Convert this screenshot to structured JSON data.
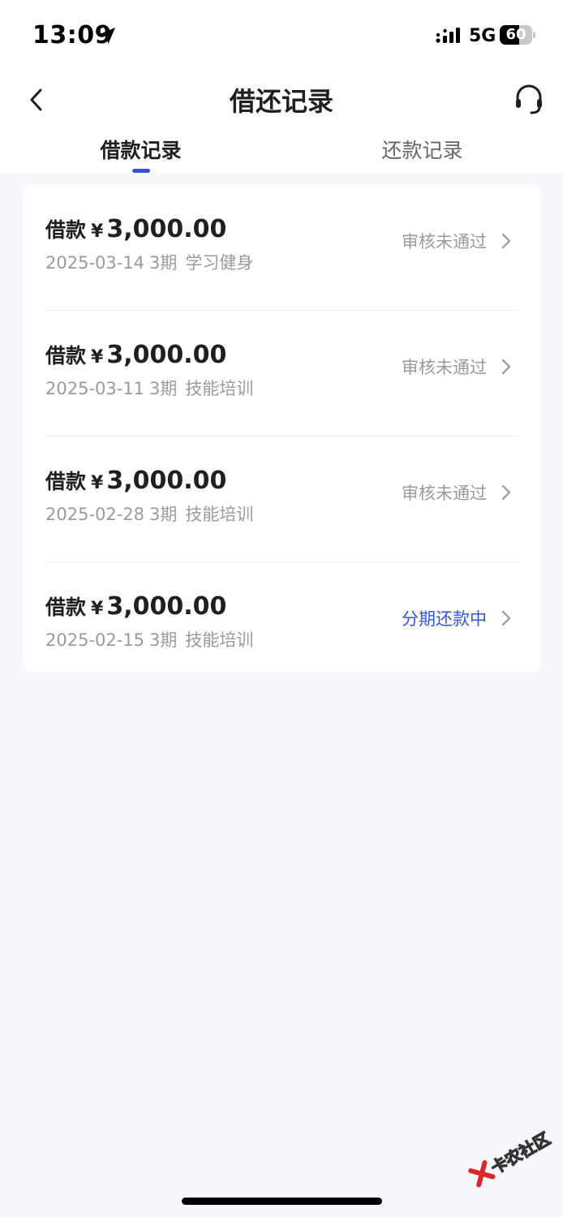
{
  "status_bar": {
    "time": "13:09",
    "network": "5G",
    "battery": "60",
    "battery_level": 0.6
  },
  "nav": {
    "title": "借还记录",
    "back_icon": "chevron-left-icon",
    "service_icon": "headset-icon"
  },
  "tabs": [
    {
      "label": "借款记录",
      "active": true
    },
    {
      "label": "还款记录",
      "active": false
    }
  ],
  "records": [
    {
      "label": "借款",
      "currency": "¥",
      "amount": "3,000.00",
      "date": "2025-03-14",
      "period": "3期",
      "purpose": "学习健身",
      "status": "审核未通过"
    },
    {
      "label": "借款",
      "currency": "¥",
      "amount": "3,000.00",
      "date": "2025-03-11",
      "period": "3期",
      "purpose": "技能培训",
      "status": "审核未通过"
    },
    {
      "label": "借款",
      "currency": "¥",
      "amount": "3,000.00",
      "date": "2025-02-28",
      "period": "3期",
      "purpose": "技能培训",
      "status": "审核未通过"
    },
    {
      "label": "借款",
      "currency": "¥",
      "amount": "3,000.00",
      "date": "2025-02-15",
      "period": "3期",
      "purpose": "技能培训",
      "status": "分期还款中"
    }
  ],
  "colors": {
    "accent": "#2f55e0",
    "muted": "#9a9a9a",
    "background": "#f7f8fc"
  },
  "watermark": {
    "text": "卡农社区"
  }
}
